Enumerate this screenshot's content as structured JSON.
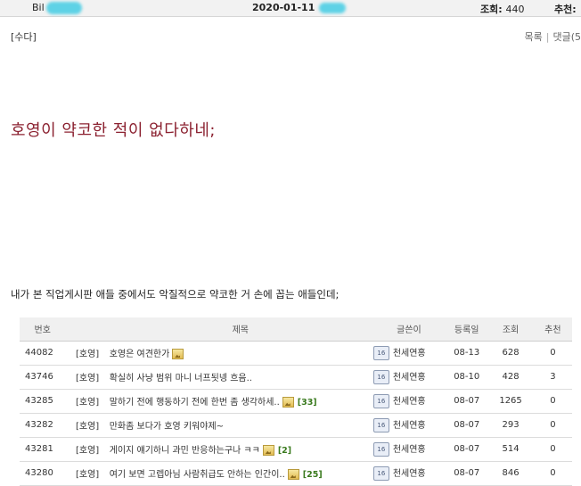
{
  "topbar": {
    "author": "Bil",
    "date": "2020-01-11",
    "views_label": "조회:",
    "views_value": "440",
    "recommend_label": "추천:"
  },
  "post": {
    "category": "[수다]",
    "links": {
      "list": "목록",
      "comments": "댓글(5"
    },
    "headline": "호영이 약코한 적이 없다하네;",
    "body": "내가 본 직업게시판 애들 중에서도 악질적으로 약코한 거 손에 꼽는 애들인데;"
  },
  "table": {
    "headers": [
      "번호",
      "제목",
      "글쓴이",
      "등록일",
      "조회",
      "추천"
    ],
    "rows": [
      {
        "num": "44082",
        "cat": "[호영]",
        "title": "호영은 여견한가",
        "img": true,
        "comments": "",
        "level": "16",
        "author": "천세연홍",
        "date": "08-13",
        "views": "628",
        "rec": "0"
      },
      {
        "num": "43746",
        "cat": "[호영]",
        "title": "확실히 사냥 범위 마니 너프됫넹 흐음..",
        "img": false,
        "comments": "",
        "level": "16",
        "author": "천세연홍",
        "date": "08-10",
        "views": "428",
        "rec": "3"
      },
      {
        "num": "43285",
        "cat": "[호영]",
        "title": "말하기 전에 행동하기 전에 한번 좀 생각하세..",
        "img": true,
        "comments": "[33]",
        "level": "16",
        "author": "천세연홍",
        "date": "08-07",
        "views": "1265",
        "rec": "0"
      },
      {
        "num": "43282",
        "cat": "[호영]",
        "title": "만화좀 보다가 호영 키워야제~",
        "img": false,
        "comments": "",
        "level": "16",
        "author": "천세연홍",
        "date": "08-07",
        "views": "293",
        "rec": "0"
      },
      {
        "num": "43281",
        "cat": "[호영]",
        "title": "게이지 얘기하니 과민 반응하는구나 ㅋㅋ",
        "img": true,
        "comments": "[2]",
        "level": "16",
        "author": "천세연홍",
        "date": "08-07",
        "views": "514",
        "rec": "0"
      },
      {
        "num": "43280",
        "cat": "[호영]",
        "title": "여기 보면 고렙아님 사람취급도 안하는 인간이..",
        "img": true,
        "comments": "[25]",
        "level": "16",
        "author": "천세연홍",
        "date": "08-07",
        "views": "846",
        "rec": "0"
      }
    ]
  }
}
